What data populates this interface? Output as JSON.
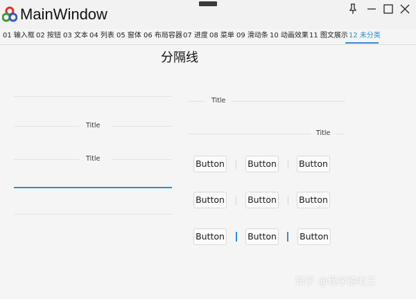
{
  "window": {
    "title": "MainWindow"
  },
  "tabs": [
    {
      "label": "01 输入框"
    },
    {
      "label": "02 按钮"
    },
    {
      "label": "03 文本"
    },
    {
      "label": "04 列表"
    },
    {
      "label": "05 窗体"
    },
    {
      "label": "06 布局容器"
    },
    {
      "label": "07 进度"
    },
    {
      "label": "08 菜单"
    },
    {
      "label": "09 滑动条"
    },
    {
      "label": "10 动画效果"
    },
    {
      "label": "11 图文展示"
    },
    {
      "label": "12 未分类"
    }
  ],
  "active_tab_index": 11,
  "page": {
    "title": "分隔线"
  },
  "dividers": {
    "right_center_label": "Title",
    "left_center_label": "Title",
    "right_end_label": "Title",
    "left_center_label_2": "Title"
  },
  "buttons": {
    "label": "Button",
    "rows": [
      [
        "Button",
        "Button",
        "Button"
      ],
      [
        "Button",
        "Button",
        "Button"
      ],
      [
        "Button",
        "Button",
        "Button"
      ]
    ]
  },
  "watermark": "知乎 @程序猿老王",
  "colors": {
    "accent": "#2f8bd6",
    "line": "#e2e2e2",
    "background": "#f5f5f5"
  },
  "icons": {
    "app_logo": "app-logo-icon",
    "pin": "pin-icon",
    "minimize": "minimize-icon",
    "maximize": "maximize-icon",
    "close": "close-icon"
  }
}
